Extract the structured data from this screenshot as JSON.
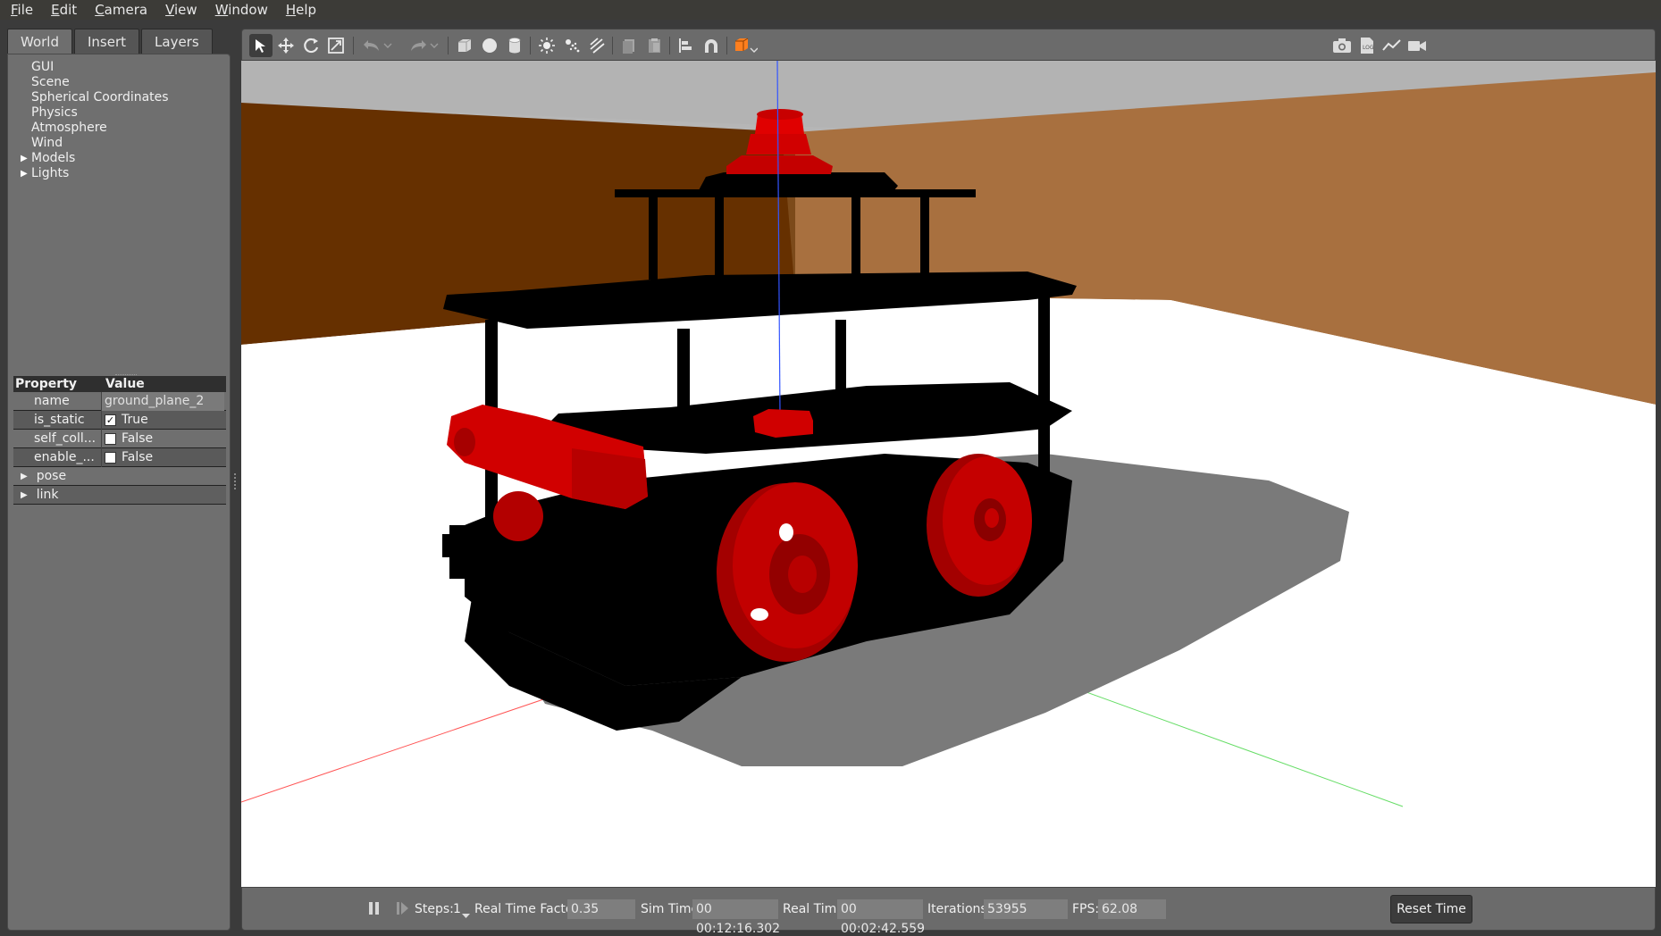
{
  "menu": {
    "items": [
      {
        "first": "F",
        "rest": "ile"
      },
      {
        "first": "E",
        "rest": "dit"
      },
      {
        "first": "C",
        "rest": "amera"
      },
      {
        "first": "V",
        "rest": "iew"
      },
      {
        "first": "W",
        "rest": "indow"
      },
      {
        "first": "H",
        "rest": "elp"
      }
    ]
  },
  "left_panel": {
    "tabs": [
      "World",
      "Insert",
      "Layers"
    ],
    "active_tab": "World",
    "tree": [
      "GUI",
      "Scene",
      "Spherical Coordinates",
      "Physics",
      "Atmosphere",
      "Wind",
      "Models",
      "Lights"
    ],
    "properties": {
      "header_property": "Property",
      "header_value": "Value",
      "rows": [
        {
          "key": "name",
          "value": "ground_plane_2"
        },
        {
          "key": "is_static",
          "value": "True",
          "checked": true
        },
        {
          "key": "self_coll...",
          "value": "False",
          "checked": false
        },
        {
          "key": "enable_...",
          "value": "False",
          "checked": false
        }
      ],
      "expandable": [
        "pose",
        "link"
      ]
    }
  },
  "toolbar": {
    "icons": [
      "select-icon",
      "translate-icon",
      "rotate-icon",
      "scale-icon",
      "undo-icon",
      "redo-icon",
      "box-icon",
      "sphere-icon",
      "cylinder-icon",
      "point-light-icon",
      "spot-light-icon",
      "directional-light-icon",
      "copy-icon",
      "paste-icon",
      "align-icon",
      "snap-icon",
      "view-angle-icon",
      "screenshot-icon",
      "log-icon",
      "plot-icon",
      "video-icon"
    ]
  },
  "bottom_bar": {
    "steps_label": "Steps:",
    "steps_value": "1",
    "rtf_label": "Real Time Factor:",
    "rtf_value": "0.35",
    "sim_time_label": "Sim Time:",
    "sim_time_value": "00 00:12:16.302",
    "real_time_label": "Real Time:",
    "real_time_value": "00 00:02:42.559",
    "iterations_label": "Iterations:",
    "iterations_value": "53955",
    "fps_label": "FPS:",
    "fps_value": "62.08",
    "reset_label": "Reset Time"
  },
  "colors": {
    "robot_red": "#d10000",
    "robot_black": "#000000",
    "wall_dark": "#663000",
    "wall_light": "#a8703f"
  }
}
